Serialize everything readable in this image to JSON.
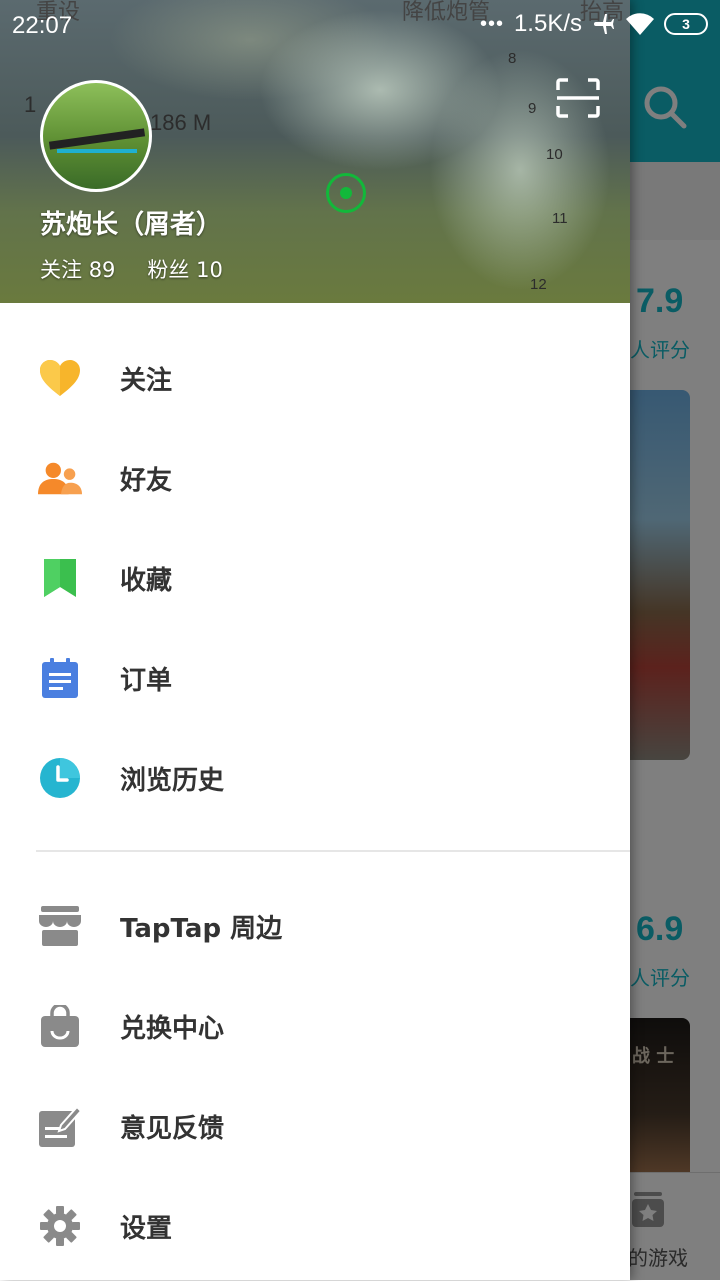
{
  "status_bar": {
    "time": "22:07",
    "network_speed": "1.5K/s",
    "battery": "3"
  },
  "background": {
    "score_1": "7.9",
    "rating_label_1": "人评分",
    "score_2": "6.9",
    "rating_label_2": "人评分",
    "card_text": "战 士",
    "nav_label": "的游戏"
  },
  "header": {
    "hud": {
      "reset": "重设",
      "lower": "降低炮管",
      "raise": "抬高",
      "distance": "186 M",
      "count": "1",
      "tick_8": "8",
      "tick_9": "9",
      "tick_10": "10",
      "tick_11": "11",
      "tick_12": "12"
    },
    "username": "苏炮长（屑者）",
    "following_label": "关注",
    "following_count": "89",
    "fans_label": "粉丝",
    "fans_count": "10"
  },
  "menu_primary": [
    {
      "label": "关注",
      "icon": "heart-icon",
      "color": "#f7b52b"
    },
    {
      "label": "好友",
      "icon": "friends-icon",
      "color": "#f5892a"
    },
    {
      "label": "收藏",
      "icon": "bookmark-icon",
      "color": "#3bbf4e"
    },
    {
      "label": "订单",
      "icon": "order-icon",
      "color": "#4a7fe0"
    },
    {
      "label": "浏览历史",
      "icon": "clock-icon",
      "color": "#26b5d0"
    }
  ],
  "menu_secondary": [
    {
      "label": "TapTap 周边",
      "icon": "store-icon"
    },
    {
      "label": "兑换中心",
      "icon": "bag-icon"
    },
    {
      "label": "意见反馈",
      "icon": "feedback-icon"
    },
    {
      "label": "设置",
      "icon": "gear-icon"
    }
  ],
  "colors": {
    "accent": "#14b9c8",
    "secondary_icon": "#8a8a8a"
  }
}
